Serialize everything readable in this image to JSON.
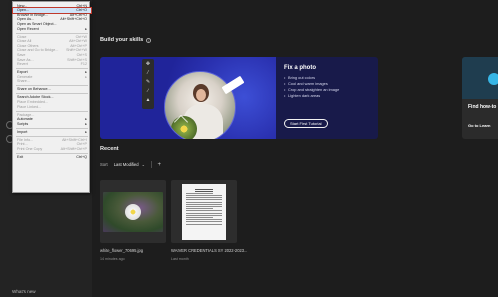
{
  "file_menu": {
    "items": [
      {
        "label": "New...",
        "shortcut": "Ctrl+N",
        "state": "normal"
      },
      {
        "label": "Open...",
        "shortcut": "Ctrl+O",
        "state": "highlight"
      },
      {
        "label": "Browse in Bridge...",
        "shortcut": "Alt+Ctrl+O",
        "state": "normal"
      },
      {
        "label": "Open As...",
        "shortcut": "Alt+Shift+Ctrl+O",
        "state": "normal"
      },
      {
        "label": "Open as Smart Object...",
        "shortcut": "",
        "state": "normal"
      },
      {
        "label": "Open Recent",
        "shortcut": "",
        "state": "submenu"
      },
      {
        "label": "Close",
        "shortcut": "Ctrl+W",
        "state": "disabled"
      },
      {
        "label": "Close All",
        "shortcut": "Alt+Ctrl+W",
        "state": "disabled"
      },
      {
        "label": "Close Others",
        "shortcut": "Alt+Ctrl+P",
        "state": "disabled"
      },
      {
        "label": "Close and Go to Bridge...",
        "shortcut": "Shift+Ctrl+W",
        "state": "disabled"
      },
      {
        "label": "Save",
        "shortcut": "Ctrl+S",
        "state": "disabled"
      },
      {
        "label": "Save As...",
        "shortcut": "Shift+Ctrl+S",
        "state": "disabled"
      },
      {
        "label": "Revert",
        "shortcut": "F12",
        "state": "disabled"
      },
      {
        "label": "Export",
        "shortcut": "",
        "state": "submenu"
      },
      {
        "label": "Generate",
        "shortcut": "",
        "state": "submenu-disabled"
      },
      {
        "label": "Share...",
        "shortcut": "",
        "state": "disabled"
      },
      {
        "label": "Share on Behance...",
        "shortcut": "",
        "state": "normal"
      },
      {
        "label": "Search Adobe Stock...",
        "shortcut": "",
        "state": "normal"
      },
      {
        "label": "Place Embedded...",
        "shortcut": "",
        "state": "disabled"
      },
      {
        "label": "Place Linked...",
        "shortcut": "",
        "state": "disabled"
      },
      {
        "label": "Package...",
        "shortcut": "",
        "state": "disabled"
      },
      {
        "label": "Automate",
        "shortcut": "",
        "state": "submenu"
      },
      {
        "label": "Scripts",
        "shortcut": "",
        "state": "submenu"
      },
      {
        "label": "Import",
        "shortcut": "",
        "state": "submenu"
      },
      {
        "label": "File Info...",
        "shortcut": "Alt+Shift+Ctrl+I",
        "state": "disabled"
      },
      {
        "label": "Print...",
        "shortcut": "Ctrl+P",
        "state": "disabled"
      },
      {
        "label": "Print One Copy",
        "shortcut": "Alt+Shift+Ctrl+P",
        "state": "disabled"
      },
      {
        "label": "Exit",
        "shortcut": "Ctrl+Q",
        "state": "normal"
      }
    ]
  },
  "skills": {
    "title": "Build your skills",
    "card": {
      "title": "Fix a photo",
      "bullets": [
        "Bring out colors",
        "Cool and warm images",
        "Crop and straighten an image",
        "Lighten dark areas"
      ],
      "button": "Start First Tutorial"
    },
    "peek": {
      "title": "Find how-to",
      "link": "Go to Learn"
    }
  },
  "recent": {
    "title": "Recent",
    "sort_label": "Sort",
    "sort_value": "Last Modified",
    "files": [
      {
        "name": "white_flower_70695.jpg",
        "meta": "14 minutes ago"
      },
      {
        "name": "WAIVER CREDENTIALS SY 2022-2023...",
        "meta": "Last month"
      }
    ]
  },
  "sidebar": {
    "whats_new": "What's new"
  },
  "colors": {
    "background": "#1d1d1d",
    "hero_blue": "#20249a",
    "menu_highlight": "#cfe3f7",
    "menu_outline": "#c0392b"
  }
}
